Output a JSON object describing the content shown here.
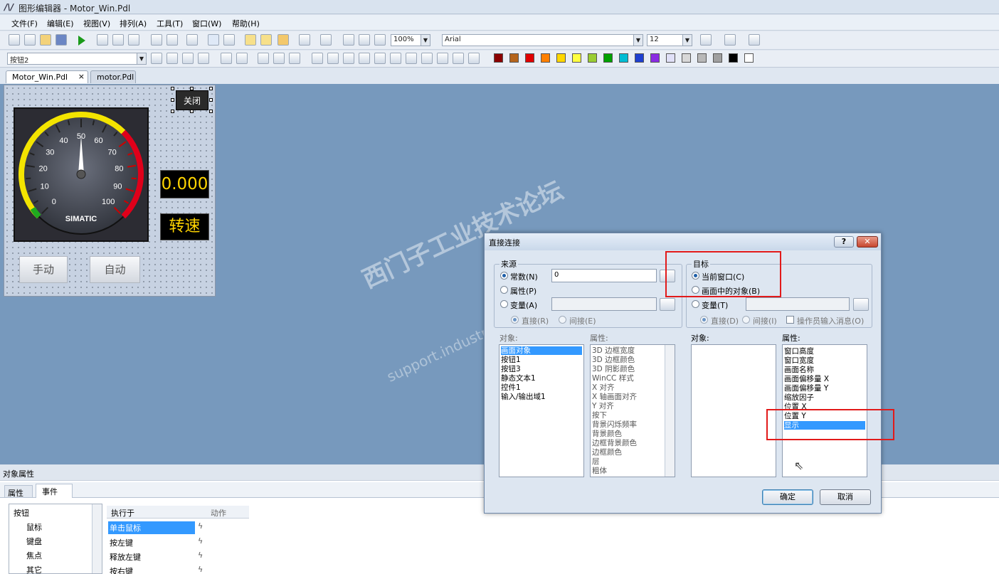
{
  "app": {
    "title": "图形编辑器 - Motor_Win.Pdl"
  },
  "menu": [
    "文件(F)",
    "编辑(E)",
    "视图(V)",
    "排列(A)",
    "工具(T)",
    "窗口(W)",
    "帮助(H)"
  ],
  "toolbar": {
    "zoom": "100%",
    "font": "Arial",
    "font_size": "12",
    "object_select": "按钮2"
  },
  "colors": [
    "#8b0000",
    "#b5651d",
    "#e00000",
    "#ff7f00",
    "#ffd700",
    "#ffff40",
    "#9acd32",
    "#00a000",
    "#00bcd4",
    "#1e3fd0",
    "#8a2be2",
    "#e0e0f8",
    "#d8d8d8",
    "#b8b8b8",
    "#a0a0a0",
    "#000000",
    "#ffffff"
  ],
  "tabs": [
    {
      "label": "Motor_Win.Pdl",
      "close": "×"
    },
    {
      "label": "motor.Pdl"
    }
  ],
  "picture": {
    "close_button": "关闭",
    "gauge_ticks": [
      "0",
      "10",
      "20",
      "30",
      "40",
      "50",
      "60",
      "70",
      "80",
      "90",
      "100"
    ],
    "gauge_ticks_list": [
      {
        "t": "0",
        "v": 0
      },
      {
        "t": "10",
        "v": 10
      },
      {
        "t": "20",
        "v": 20
      },
      {
        "t": "30",
        "v": 30
      },
      {
        "t": "40",
        "v": 40
      },
      {
        "t": "50",
        "v": 50
      },
      {
        "t": "60",
        "v": 60
      },
      {
        "t": "70",
        "v": 70
      },
      {
        "t": "80",
        "v": 80
      },
      {
        "t": "90",
        "v": 90
      },
      {
        "t": "100",
        "v": 100
      }
    ],
    "gauge_brand": "SIMATIC",
    "gauge_value": 50,
    "value_display": "0.000",
    "speed_label": "转速",
    "manual_button": "手动",
    "auto_button": "自动"
  },
  "watermark": {
    "cn": "西门子工业技术论坛",
    "url": "support.industry.siemens.com/cs"
  },
  "dialog": {
    "title": "直接连接",
    "help": "?",
    "close": "✕",
    "source": {
      "title": "来源",
      "constant": "常数(N)",
      "constant_value": "0",
      "property": "属性(P)",
      "variable": "变量(A)",
      "direct": "直接(R)",
      "indirect": "间接(E)",
      "objects_label": "对象:",
      "props_label": "属性:",
      "objects": [
        "画面对象",
        "按钮1",
        "按钮3",
        "静态文本1",
        "控件1",
        "输入/输出域1"
      ],
      "properties": [
        "3D 边框宽度",
        "3D 边框颜色",
        "3D 阴影颜色",
        "WinCC 样式",
        "X 对齐",
        "X 轴画面对齐",
        "Y 对齐",
        "按下",
        "背景闪烁频率",
        "背景颜色",
        "边框背景颜色",
        "边框颜色",
        "层",
        "粗体"
      ]
    },
    "target": {
      "title": "目标",
      "current_window": "当前窗口(C)",
      "object_in_picture": "画面中的对象(B)",
      "variable": "变量(T)",
      "direct": "直接(D)",
      "indirect": "间接(I)",
      "operator_msg": "操作员输入消息(O)",
      "objects_label": "对象:",
      "props_label": "属性:",
      "properties": [
        "窗口高度",
        "窗口宽度",
        "画面名称",
        "画面偏移量 X",
        "画面偏移量 Y",
        "缩放因子",
        "位置 X",
        "位置 Y",
        "显示"
      ]
    },
    "ok": "确定",
    "cancel": "取消"
  },
  "object_props": {
    "title": "对象属性",
    "tabs": [
      "属性",
      "事件"
    ],
    "tree": [
      "按钮",
      "鼠标",
      "键盘",
      "焦点",
      "其它"
    ],
    "col_exec": "执行于",
    "col_action": "动作",
    "events": [
      "单击鼠标",
      "按左键",
      "释放左键",
      "按右键"
    ]
  }
}
